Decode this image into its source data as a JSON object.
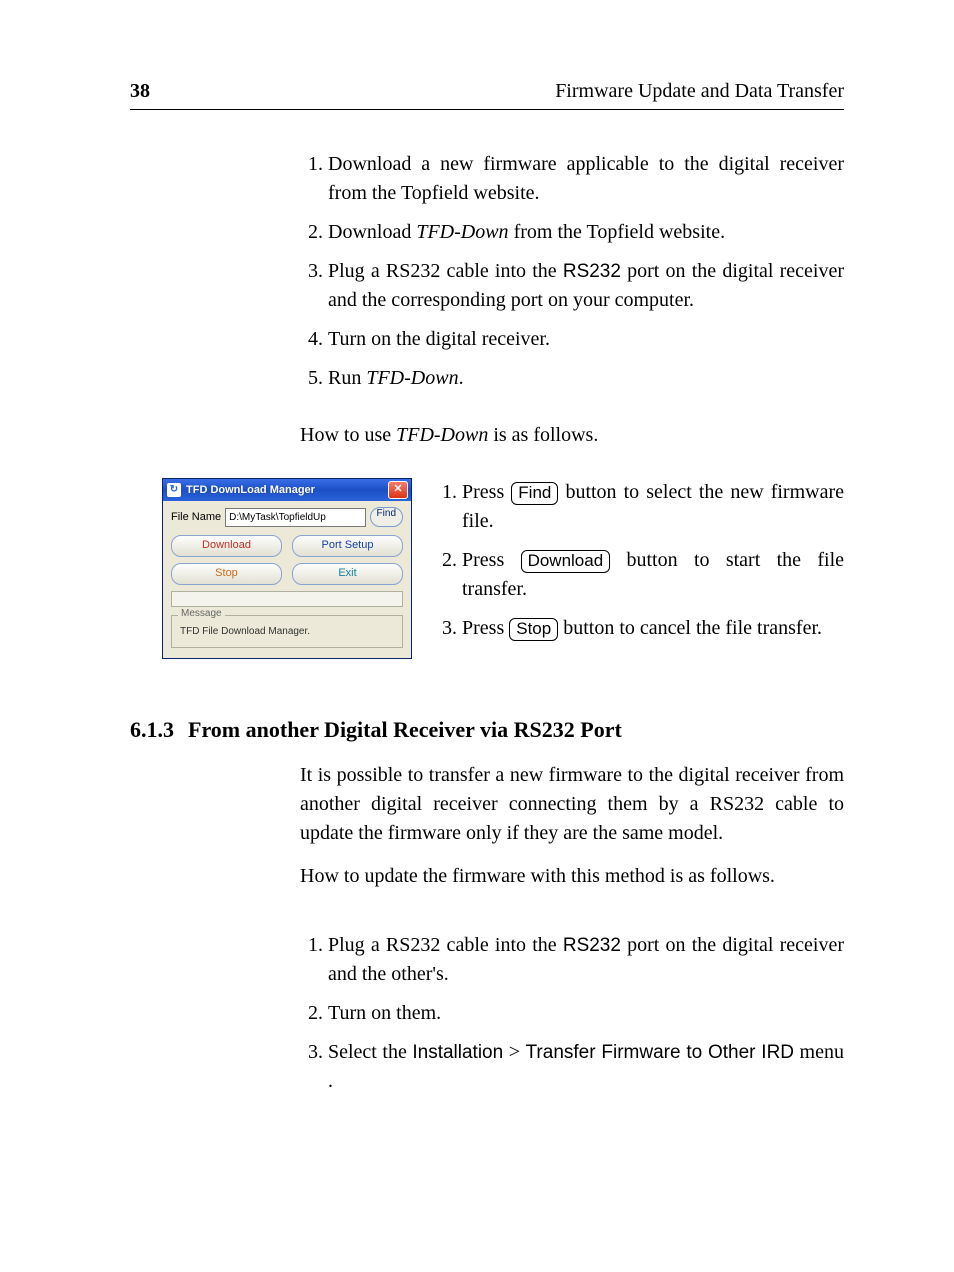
{
  "page_number": "38",
  "running_head": "Firmware Update and Data Transfer",
  "steps_a": [
    {
      "pre": "Download a new firmware applicable to the digital receiver from the Topfield website."
    },
    {
      "pre": "Download ",
      "it": "TFD-Down",
      "post": " from the Topfield website."
    },
    {
      "pre": "Plug a RS232 cable into the ",
      "sf": "RS232",
      "post": " port on the digital receiver and the corresponding port on your computer."
    },
    {
      "pre": "Turn on the digital receiver."
    },
    {
      "pre": "Run ",
      "it": "TFD-Down",
      "post": "."
    }
  ],
  "howto_tfd_pre": "How to use ",
  "howto_tfd_it": "TFD-Down",
  "howto_tfd_post": " is as follows.",
  "app": {
    "title": "TFD DownLoad Manager",
    "close": "✕",
    "icon": "↻",
    "filename_label": "File Name",
    "filename_value": "D:\\MyTask\\TopfieldUp",
    "find": "Find",
    "download": "Download",
    "portsetup": "Port Setup",
    "stop": "Stop",
    "exit": "Exit",
    "message_label": "Message",
    "message_text": "TFD File Download Manager."
  },
  "steps_b": [
    {
      "pre": "Press ",
      "key": "Find",
      "post": " button to select the new firmware file."
    },
    {
      "pre": "Press ",
      "key": "Download",
      "post": " button to start the file transfer."
    },
    {
      "pre": "Press ",
      "key": "Stop",
      "post": " button to cancel the file transfer."
    }
  ],
  "section_number": "6.1.3",
  "section_title": "From another Digital Receiver via RS232 Port",
  "para_613a": "It is possible to transfer a new firmware to the digital receiver from another digital receiver connecting them by a RS232 cable to update the firmware only if they are the same model.",
  "para_613b": "How to update the firmware with this method is as follows.",
  "steps_c": [
    {
      "pre": "Plug a RS232 cable into the ",
      "sf": "RS232",
      "post": " port on the digital receiver and the other's."
    },
    {
      "pre": "Turn on them."
    },
    {
      "pre": "Select the ",
      "sf": "Installation",
      "mid": " > ",
      "sf2": "Transfer Firmware to Other IRD",
      "post": " menu ."
    }
  ]
}
